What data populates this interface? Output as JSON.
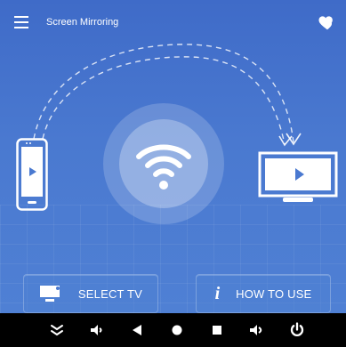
{
  "app": {
    "title": "Screen Mirroring",
    "accent": "#4a79d0",
    "icons": {
      "menu": "menu-icon",
      "favorite": "heart-icon",
      "phone": "phone-icon",
      "tv": "tv-icon",
      "wifi": "wifi-icon"
    }
  },
  "buttons": {
    "select_tv": {
      "label": "SELECT TV",
      "icon": "tv-icon"
    },
    "how_to_use": {
      "label": "HOW TO USE",
      "icon": "info-icon"
    }
  },
  "navbar": {
    "items": [
      {
        "name": "collapse-icon"
      },
      {
        "name": "volume-down-icon"
      },
      {
        "name": "back-icon"
      },
      {
        "name": "home-icon"
      },
      {
        "name": "recents-icon"
      },
      {
        "name": "volume-up-icon"
      },
      {
        "name": "power-icon"
      }
    ]
  }
}
